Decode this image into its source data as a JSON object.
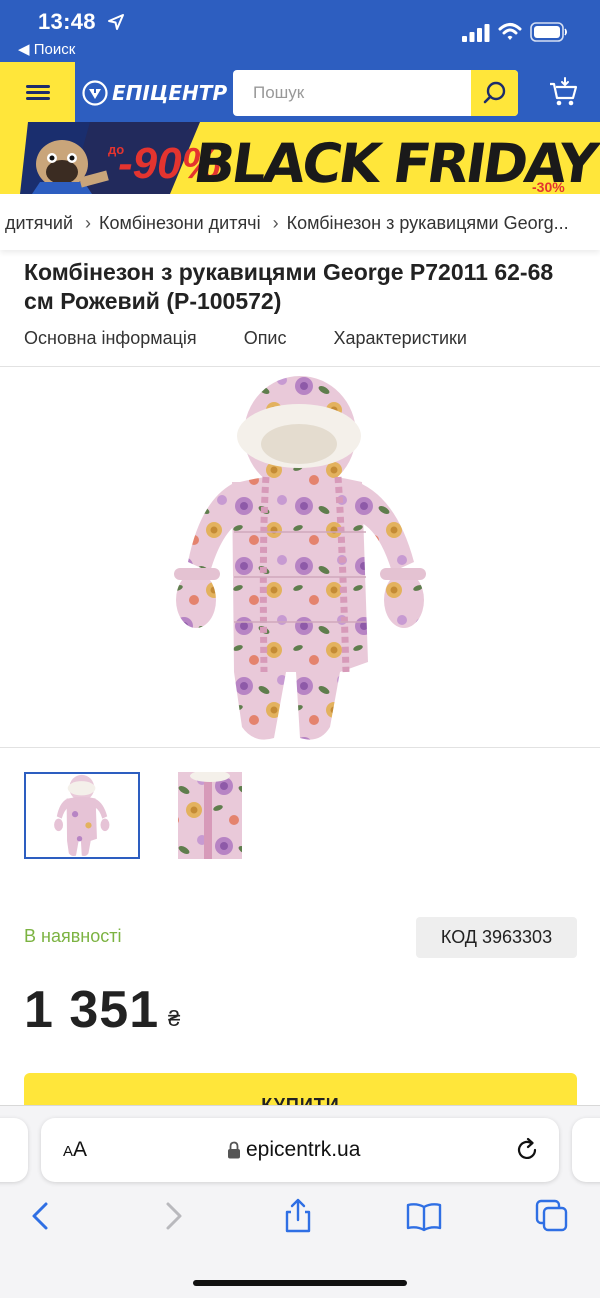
{
  "status_bar": {
    "time": "13:48",
    "back_app": "◀ Поиск"
  },
  "header": {
    "logo_text": "ЕПІЦЕНТР",
    "search_placeholder": "Пошук",
    "colors": {
      "header_blue": "#2d5ec0",
      "accent_yellow": "#ffe63a"
    }
  },
  "banner": {
    "discount": "-90%",
    "discount_prefix": "до",
    "headline": "BLACK FRIDAY",
    "small_text": "-30%"
  },
  "breadcrumb": [
    "дитячий",
    "Комбінезони дитячі",
    "Комбінезон з рукавицями Georg..."
  ],
  "product": {
    "title": "Комбінезон з рукавицями George P72011 62-68 см Рожевий (P-100572)",
    "tabs": [
      "Основна інформація",
      "Опис",
      "Характеристики"
    ],
    "availability": "В наявності",
    "code": "КОД 3963303",
    "price": "1 351",
    "currency": "₴",
    "buy_label": "КУПИТИ"
  },
  "safari": {
    "aa_label_small": "A",
    "aa_label_large": "A",
    "url": "epicentrk.ua"
  },
  "icons": [
    "location-arrow-icon",
    "signal-icon",
    "wifi-icon",
    "battery-icon",
    "menu-icon",
    "logo-icon",
    "search-icon",
    "cart-icon",
    "lock-icon",
    "reload-icon",
    "back-icon",
    "forward-icon",
    "share-icon",
    "bookmarks-icon",
    "tabs-icon"
  ]
}
